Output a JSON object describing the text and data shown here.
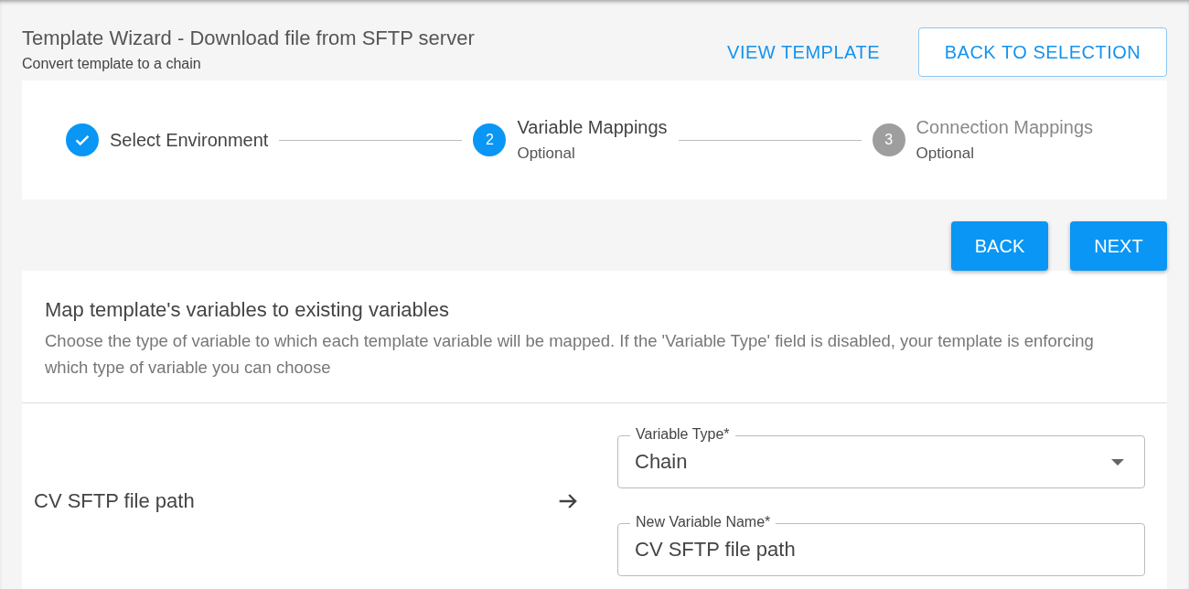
{
  "header": {
    "title": "Template Wizard - Download file from SFTP server",
    "subtitle": "Convert template to a chain",
    "actions": [
      {
        "label": "VIEW TEMPLATE",
        "kind": "text"
      },
      {
        "label": "BACK TO SELECTION",
        "kind": "outlined"
      }
    ]
  },
  "steps": [
    {
      "label": "Select Environment",
      "completed": true,
      "active": true
    },
    {
      "number": "2",
      "label": "Variable Mappings",
      "sublabel": "Optional",
      "completed": false,
      "active": true
    },
    {
      "number": "3",
      "label": "Connection Mappings",
      "sublabel": "Optional",
      "completed": false,
      "active": false
    }
  ],
  "nav_buttons": [
    "BACK",
    "NEXT"
  ],
  "mapping": {
    "title": "Map template's variables to existing variables",
    "description": "Choose the type of variable to which each template variable will be mapped. If the 'Variable Type' field is disabled, your template is enforcing which type of variable you can choose",
    "rows": [
      {
        "source": "CV SFTP file path",
        "type_field": {
          "label": "Variable Type*",
          "value": "Chain"
        },
        "name_field": {
          "label": "New Variable Name*",
          "value": "CV SFTP file path"
        }
      }
    ]
  }
}
